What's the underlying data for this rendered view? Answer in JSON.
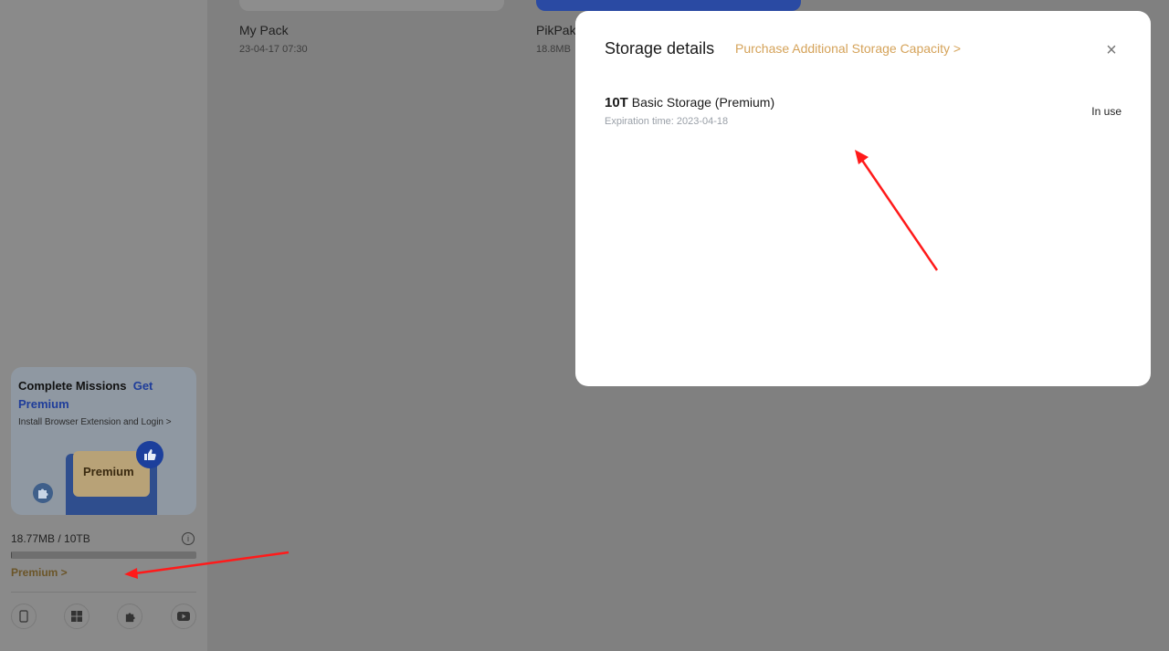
{
  "files": [
    {
      "name": "My Pack",
      "meta": "23-04-17 07:30"
    },
    {
      "name": "PikPak",
      "meta": "18.8MB"
    }
  ],
  "promo": {
    "title": "Complete Missions",
    "title_highlight": "Get Premium",
    "subtitle": "Install Browser Extension and Login >",
    "badge": "Premium",
    "thumb_icon": "thumbs-up-icon",
    "puzzle_icon": "puzzle-icon"
  },
  "storage_usage": {
    "text": "18.77MB / 10TB",
    "fill_fraction": 1e-05
  },
  "premium_link": "Premium  >",
  "app_icons": [
    "phone-icon",
    "windows-icon",
    "extension-icon",
    "youtube-icon"
  ],
  "modal": {
    "title": "Storage details",
    "purchase_link": "Purchase Additional Storage Capacity >",
    "close_glyph": "×",
    "item": {
      "amount": "10T",
      "label": "Basic Storage (Premium)",
      "expiry": "Expiration time: 2023-04-18",
      "status": "In use"
    }
  },
  "colors": {
    "accent": "#d5a35a",
    "annotation": "#ff1a1a",
    "overlay": "#808080"
  }
}
